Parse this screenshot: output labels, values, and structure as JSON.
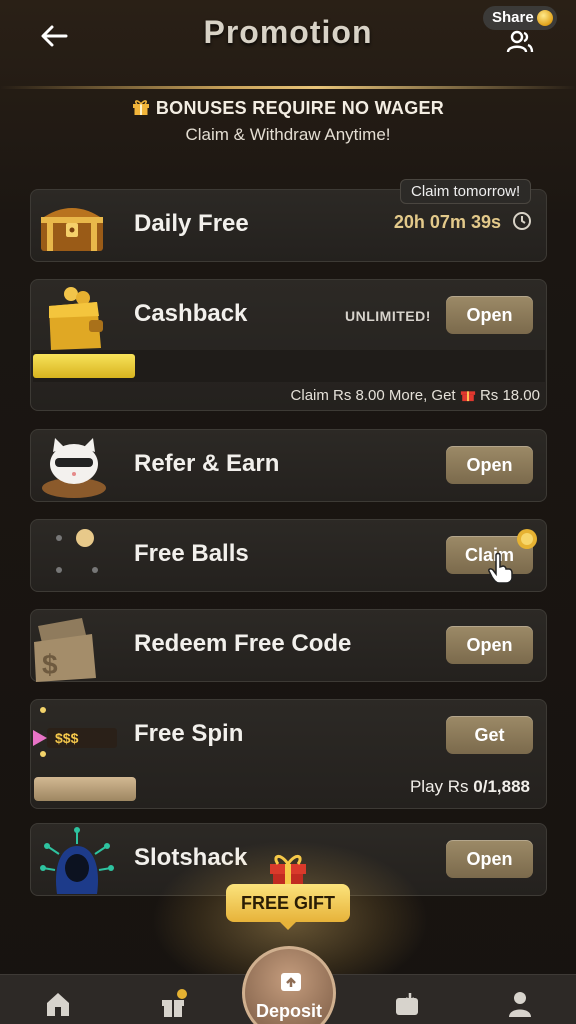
{
  "header": {
    "title": "Promotion",
    "share_label": "Share"
  },
  "notice": {
    "title": "BONUSES REQUIRE NO WAGER",
    "subtitle": "Claim & Withdraw Anytime!"
  },
  "daily_free": {
    "label": "Daily Free",
    "claim_tag": "Claim tomorrow!",
    "timer": "20h 07m 39s"
  },
  "cashback": {
    "label": "Cashback",
    "unlimited": "UNLIMITED!",
    "button": "Open",
    "progress_fraction": 0.2,
    "claim_prefix": "Claim Rs 8.00 More, Get",
    "claim_reward": "Rs 18.00"
  },
  "refer": {
    "label": "Refer & Earn",
    "button": "Open"
  },
  "free_balls": {
    "label": "Free Balls",
    "button": "Claim"
  },
  "redeem": {
    "label": "Redeem Free Code",
    "button": "Open"
  },
  "free_spin": {
    "label": "Free Spin",
    "button": "Get",
    "icon_text": "$$$",
    "play_prefix": "Play Rs",
    "play_progress": "0/1,888"
  },
  "slotshack": {
    "label": "Slotshack",
    "button": "Open"
  },
  "free_gift": {
    "label": "FREE GIFT"
  },
  "bottom_nav": {
    "deposit": "Deposit"
  },
  "colors": {
    "accent_gold": "#e3c98a",
    "button": "#8b7a59",
    "progress": "#e8cb3a"
  }
}
